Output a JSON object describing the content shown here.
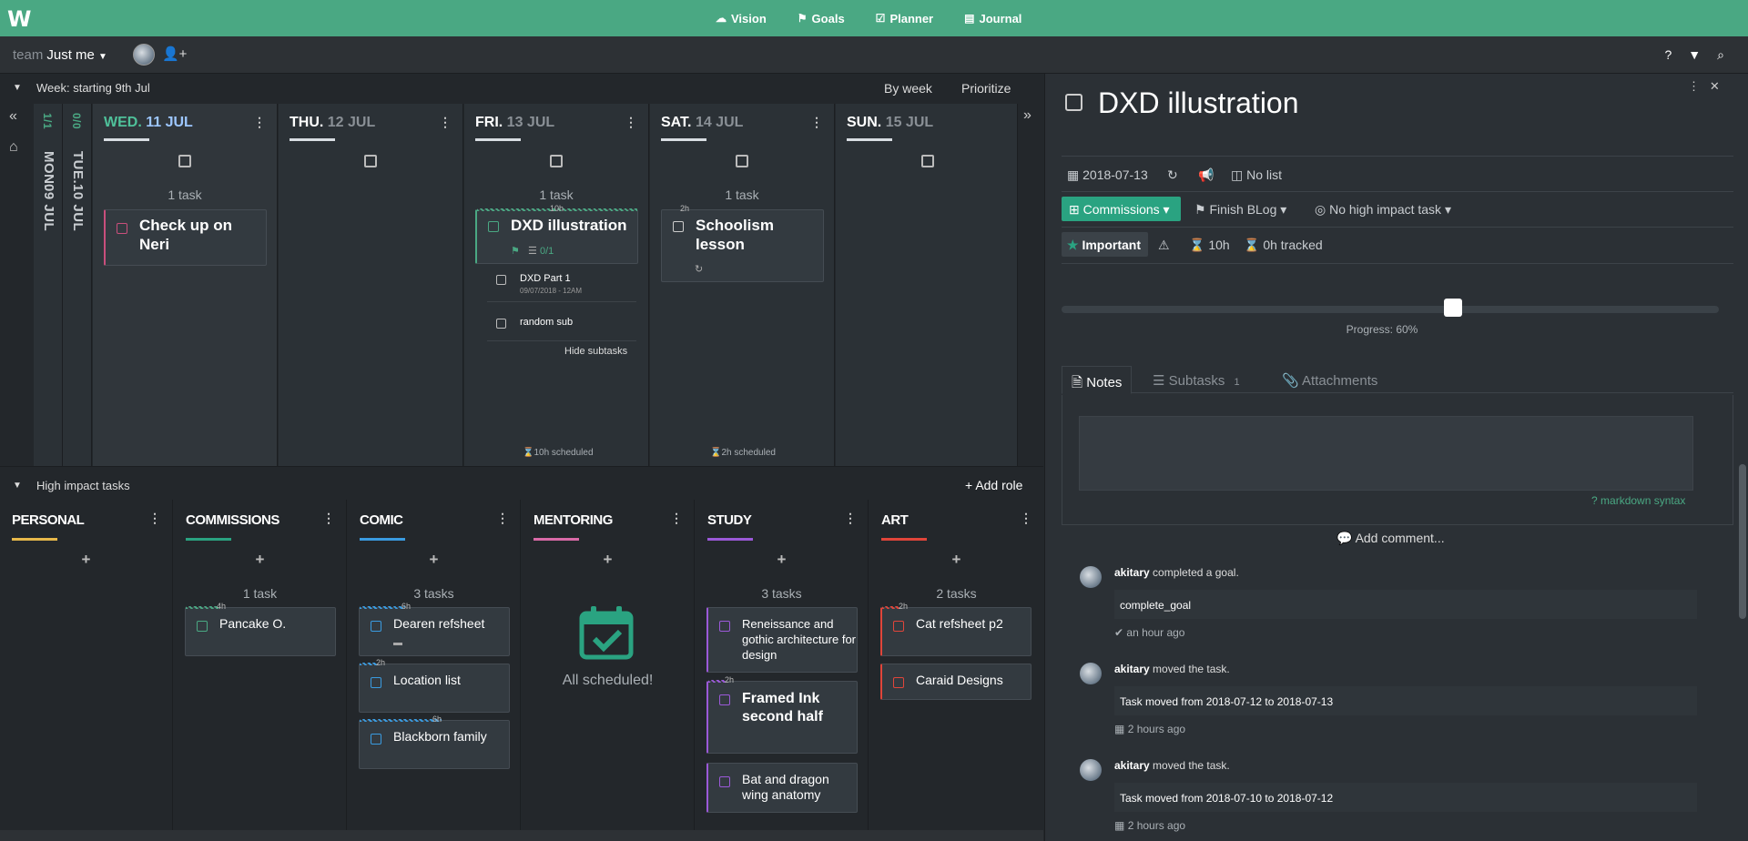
{
  "topnav": {
    "logo": "W",
    "items": [
      {
        "label": "Vision",
        "icon": "cloud-icon"
      },
      {
        "label": "Goals",
        "icon": "flag-icon"
      },
      {
        "label": "Planner",
        "icon": "calendar-check-icon"
      },
      {
        "label": "Journal",
        "icon": "book-icon"
      }
    ]
  },
  "subbar": {
    "team_label": "team",
    "team_value": "Just me"
  },
  "week": {
    "label": "Week: starting 9th Jul",
    "view": "By week",
    "prioritize": "Prioritize",
    "collapsed_days": [
      {
        "name": "MON.",
        "date": "09 JUL",
        "count": "1/1"
      },
      {
        "name": "TUE.",
        "date": "10 JUL",
        "count": "0/0"
      }
    ],
    "days": [
      {
        "name": "WED.",
        "date": "11 JUL",
        "task_count": "1 task"
      },
      {
        "name": "THU.",
        "date": "12 JUL",
        "task_count": ""
      },
      {
        "name": "FRI.",
        "date": "13 JUL",
        "task_count": "1 task",
        "scheduled": "10h scheduled"
      },
      {
        "name": "SAT.",
        "date": "14 JUL",
        "task_count": "1 task",
        "scheduled": "2h scheduled"
      },
      {
        "name": "SUN.",
        "date": "15 JUL",
        "task_count": ""
      }
    ],
    "tasks": {
      "wed": {
        "title": "Check up on Neri"
      },
      "fri": {
        "title": "DXD illustration",
        "estimate": "10h",
        "subcount": "0/1"
      },
      "sat": {
        "title": "Schoolism lesson",
        "estimate": "2h"
      }
    },
    "subtasks": [
      {
        "title": "DXD Part 1",
        "meta": "09/07/2018 - 12AM"
      },
      {
        "title": "random sub",
        "meta": ""
      }
    ],
    "hide_subtasks": "Hide subtasks"
  },
  "high_impact": {
    "label": "High impact tasks",
    "add_role": "Add role",
    "roles": [
      {
        "name": "PERSONAL",
        "color": "#e6b84a",
        "count": ""
      },
      {
        "name": "COMMISSIONS",
        "color": "#2aa381",
        "count": "1 task"
      },
      {
        "name": "COMIC",
        "color": "#3a9be0",
        "count": "3 tasks"
      },
      {
        "name": "MENTORING",
        "color": "#d96aa8",
        "count": "",
        "all_scheduled": "All scheduled!"
      },
      {
        "name": "STUDY",
        "color": "#9b59d8",
        "count": "3 tasks"
      },
      {
        "name": "ART",
        "color": "#e0453a",
        "count": "2 tasks"
      }
    ],
    "tasks": {
      "commissions": [
        {
          "title": "Pancake O.",
          "estimate": "4h"
        }
      ],
      "comic": [
        {
          "title": "Dearen refsheet",
          "estimate": "6h"
        },
        {
          "title": "Location list",
          "estimate": "2h"
        },
        {
          "title": "Blackborn family",
          "estimate": "6h"
        }
      ],
      "study": [
        {
          "title": "Reneissance and gothic architecture for design",
          "estimate": ""
        },
        {
          "title": "Framed Ink second half",
          "estimate": "2h"
        },
        {
          "title": "Bat and dragon wing anatomy",
          "estimate": ""
        }
      ],
      "art": [
        {
          "title": "Cat refsheet p2",
          "estimate": "2h"
        },
        {
          "title": "Caraid Designs",
          "estimate": ""
        }
      ]
    }
  },
  "detail": {
    "title": "DXD illustration",
    "date": "2018-07-13",
    "list": "No list",
    "role": "Commissions",
    "goal": "Finish BLog",
    "high_impact": "No high impact task",
    "important": "Important",
    "estimate": "10h",
    "tracked": "0h tracked",
    "progress_value": 0.6,
    "progress_label": "Progress: 60%",
    "tabs": [
      {
        "label": "Notes",
        "count": ""
      },
      {
        "label": "Subtasks",
        "count": "1"
      },
      {
        "label": "Attachments",
        "count": ""
      }
    ],
    "markdown": "markdown syntax",
    "add_comment": "Add comment...",
    "comments": [
      {
        "user": "akitary",
        "action": "completed a goal.",
        "body": "complete_goal",
        "time": "an hour ago"
      },
      {
        "user": "akitary",
        "action": "moved the task.",
        "body": "Task moved from 2018-07-12 to 2018-07-13",
        "time": "2 hours ago"
      },
      {
        "user": "akitary",
        "action": "moved the task.",
        "body": "Task moved from 2018-07-10 to 2018-07-12",
        "time": "2 hours ago"
      }
    ]
  }
}
